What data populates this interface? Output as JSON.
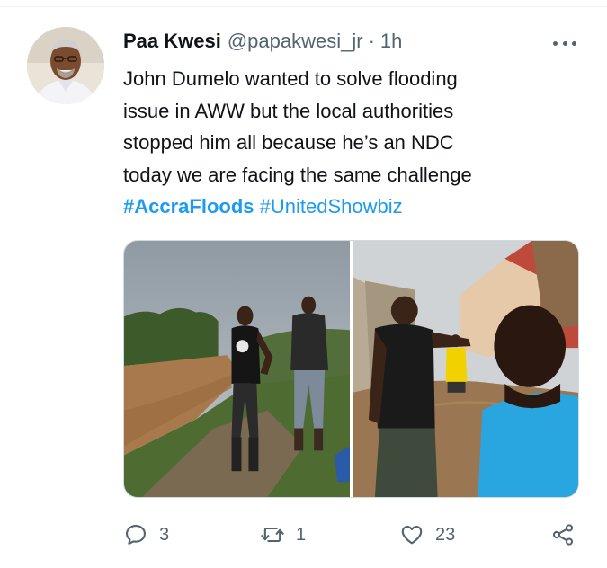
{
  "tweet": {
    "author": {
      "display_name": "Paa Kwesi",
      "handle": "@papakwesi_jr",
      "separator": "·",
      "time_ago": "1h"
    },
    "text_lines": [
      "John Dumelo wanted to solve flooding",
      "issue in AWW but the local authorities",
      "stopped him all because he’s an NDC",
      "today we are facing the same challenge"
    ],
    "hashtags": [
      "#AccraFloods",
      "#UnitedShowbiz"
    ],
    "stats": {
      "replies": "3",
      "retweets": "1",
      "likes": "23"
    }
  },
  "icons": {
    "reply": "speech-bubble-icon",
    "retweet": "retweet-arrows-icon",
    "like": "heart-icon",
    "share": "share-nodes-icon",
    "more": "more-dots-icon"
  },
  "colors": {
    "link": "#1d9bf0",
    "text": "#0f1419",
    "secondary": "#536471",
    "border": "#cfd9de"
  }
}
